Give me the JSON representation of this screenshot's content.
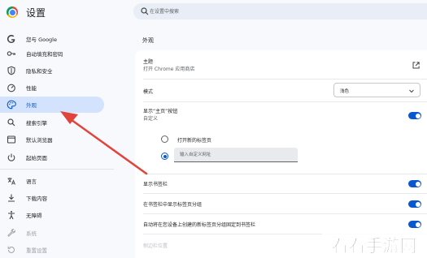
{
  "app": {
    "title": "设置"
  },
  "search": {
    "placeholder": "在设置中搜索"
  },
  "sidebar": {
    "items": [
      {
        "label": "您与 Google",
        "icon": "google-icon"
      },
      {
        "label": "自动填充和密码",
        "icon": "key-icon"
      },
      {
        "label": "隐私和安全",
        "icon": "shield-icon"
      },
      {
        "label": "性能",
        "icon": "speedometer-icon"
      },
      {
        "label": "外观",
        "icon": "palette-icon",
        "active": true
      },
      {
        "label": "搜索引擎",
        "icon": "search-icon"
      },
      {
        "label": "默认浏览器",
        "icon": "browser-icon"
      },
      {
        "label": "起始页面",
        "icon": "power-icon"
      },
      {
        "label": "语言",
        "icon": "translate-icon"
      },
      {
        "label": "下载内容",
        "icon": "download-icon"
      },
      {
        "label": "无障碍",
        "icon": "accessibility-icon"
      },
      {
        "label": "系统",
        "icon": "wrench-icon"
      },
      {
        "label": "重置设置",
        "icon": "reset-icon"
      }
    ]
  },
  "main": {
    "section_title": "外观",
    "theme": {
      "title": "主题",
      "subtitle": "打开 Chrome 应用商店",
      "icon": "open-external-icon"
    },
    "mode": {
      "label": "模式",
      "value": "浅色",
      "icon": "chevron-down-icon"
    },
    "home_button": {
      "title": "显示“主页”按钮",
      "subtitle": "自定义",
      "on": true
    },
    "home_options": [
      {
        "label": "打开新的标签页",
        "selected": false
      },
      {
        "selected": true
      }
    ],
    "custom_url": {
      "placeholder": "输入自定义网址"
    },
    "bookmarks_bar": {
      "label": "显示书签栏",
      "on": true
    },
    "tab_groups": {
      "label": "在书签栏中显示标签页分组",
      "on": true
    },
    "auto_pin": {
      "label": "自动将在您设备上创建的新标签页分组固定到书签栏",
      "on": true
    },
    "side_panel": {
      "label": "侧边栏位置"
    }
  },
  "annotation": {
    "arrow_color": "#e0443a"
  },
  "watermark": {
    "text": "看看手游网"
  },
  "colors": {
    "accent": "#0b57d0",
    "active_bg": "#d3e3fd",
    "page_bg": "#f8f9fd"
  }
}
